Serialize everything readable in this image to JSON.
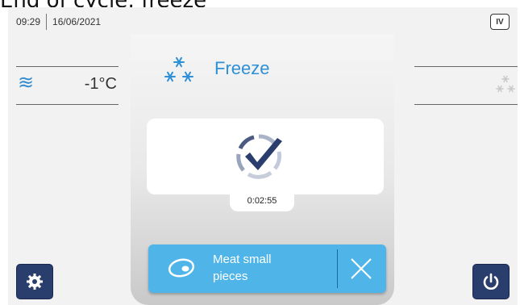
{
  "caption": "End of cycle: freeze",
  "status": {
    "time": "09:29",
    "date": "16/06/2021",
    "badge": "IV"
  },
  "probe": {
    "icon": "wave-icon",
    "temperature": "-1°C"
  },
  "cycle": {
    "mode_icon": "snowflakes-icon",
    "mode": "Freeze",
    "status_icon": "cycle-complete-check-icon",
    "elapsed": "0:02:55"
  },
  "program": {
    "icon": "meat-icon",
    "label_line1": "Meat small",
    "label_line2": "pieces"
  },
  "colors": {
    "accent": "#2e90d6",
    "program_button": "#4fb5e8",
    "dark_button": "#2a3e6e",
    "snowflake_inactive": "#c8c8c8"
  }
}
